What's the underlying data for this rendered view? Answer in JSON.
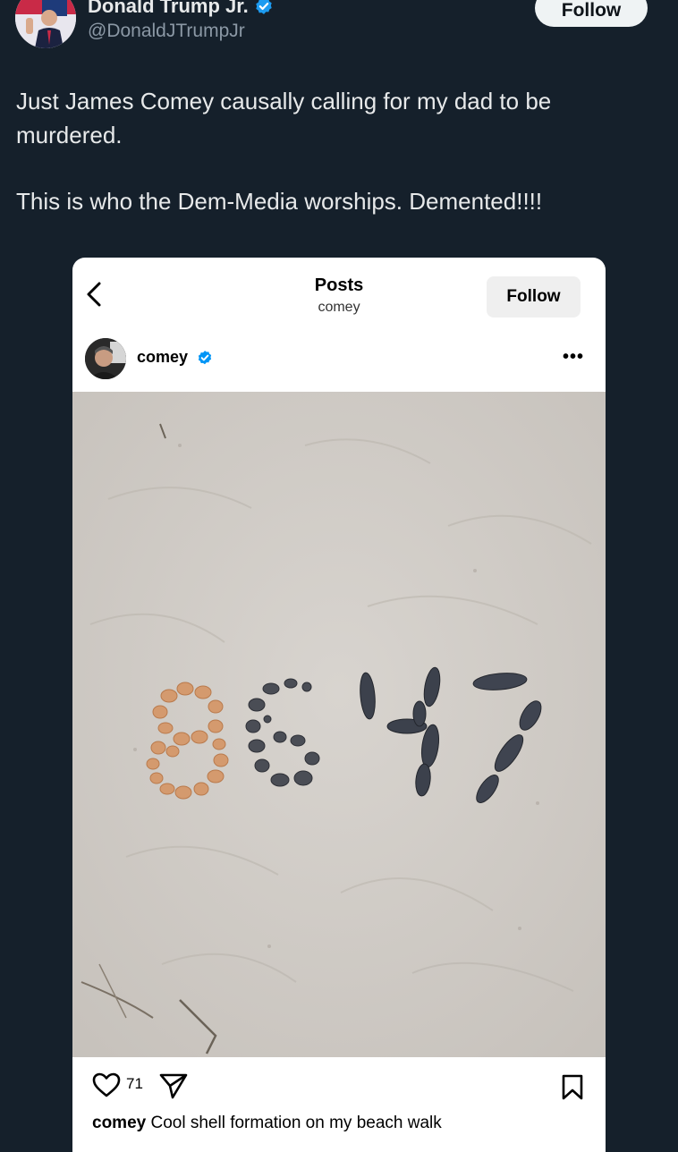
{
  "tweet": {
    "display_name": "Donald Trump Jr.",
    "handle": "@DonaldJTrumpJr",
    "follow_label": "Follow",
    "text_line1": "Just James Comey causally calling for my dad to be murdered.",
    "text_line2": "This is who the Dem-Media worships. Demented!!!!"
  },
  "embed": {
    "title": "Posts",
    "subtitle": "comey",
    "follow_label": "Follow",
    "username": "comey",
    "more_label": "•••",
    "like_count": "71",
    "caption_user": "comey",
    "caption_text": "Cool shell formation on my beach walk",
    "photo_text": "8647"
  },
  "colors": {
    "background": "#15202b",
    "text": "#e7e9ea",
    "secondary_text": "#8b98a5",
    "verified": "#1d9bf0",
    "sand": "#d3cfca"
  },
  "icons": {
    "verified": "verified-badge-icon",
    "back": "chevron-left-icon",
    "like": "heart-icon",
    "share": "paper-plane-icon",
    "save": "bookmark-icon"
  }
}
